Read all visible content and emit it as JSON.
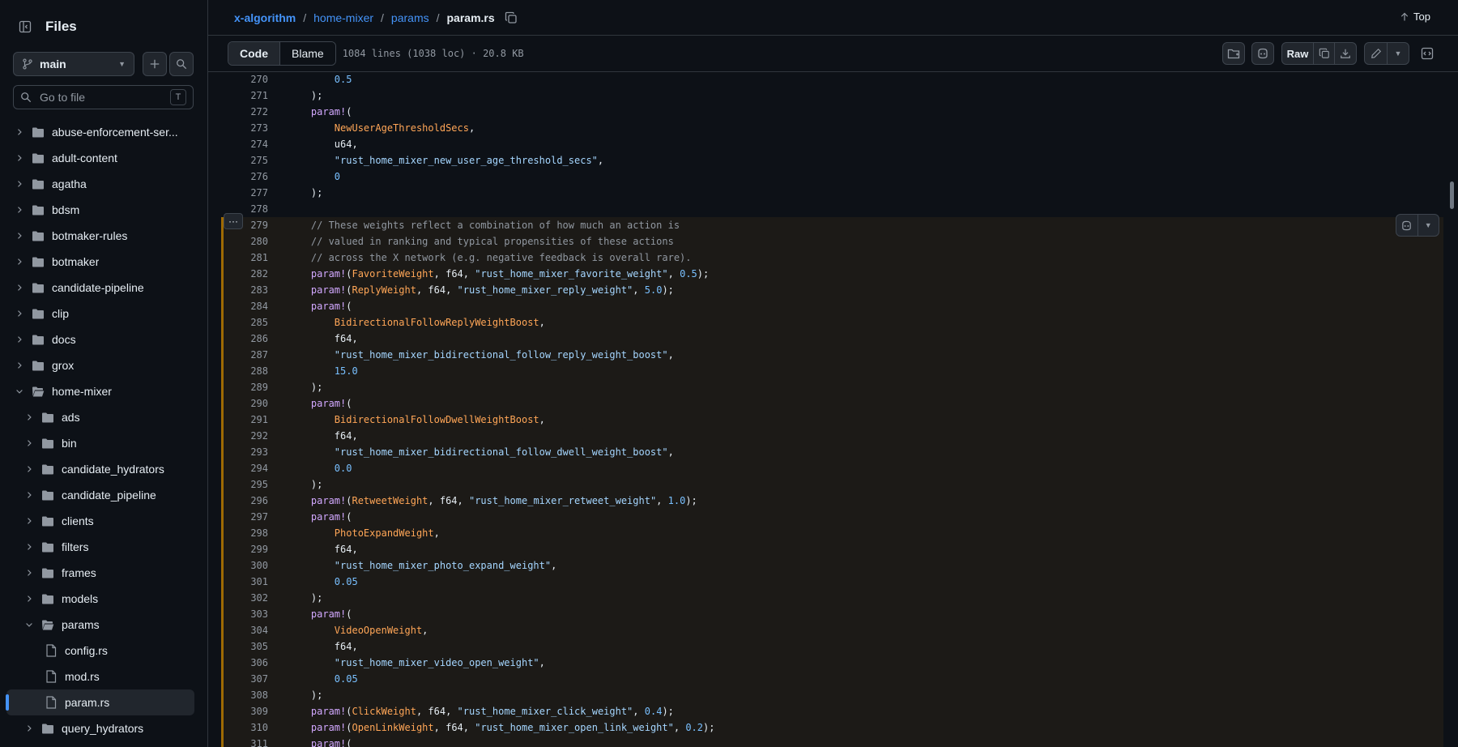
{
  "sidebar": {
    "title": "Files",
    "branch": "main",
    "goto_placeholder": "Go to file",
    "goto_shortcut": "T",
    "items": [
      {
        "label": "abuse-enforcement-ser...",
        "type": "folder",
        "depth": 0,
        "expanded": false
      },
      {
        "label": "adult-content",
        "type": "folder",
        "depth": 0,
        "expanded": false
      },
      {
        "label": "agatha",
        "type": "folder",
        "depth": 0,
        "expanded": false
      },
      {
        "label": "bdsm",
        "type": "folder",
        "depth": 0,
        "expanded": false
      },
      {
        "label": "botmaker-rules",
        "type": "folder",
        "depth": 0,
        "expanded": false
      },
      {
        "label": "botmaker",
        "type": "folder",
        "depth": 0,
        "expanded": false
      },
      {
        "label": "candidate-pipeline",
        "type": "folder",
        "depth": 0,
        "expanded": false
      },
      {
        "label": "clip",
        "type": "folder",
        "depth": 0,
        "expanded": false
      },
      {
        "label": "docs",
        "type": "folder",
        "depth": 0,
        "expanded": false
      },
      {
        "label": "grox",
        "type": "folder",
        "depth": 0,
        "expanded": false
      },
      {
        "label": "home-mixer",
        "type": "folder",
        "depth": 0,
        "expanded": true
      },
      {
        "label": "ads",
        "type": "folder",
        "depth": 1,
        "expanded": false
      },
      {
        "label": "bin",
        "type": "folder",
        "depth": 1,
        "expanded": false
      },
      {
        "label": "candidate_hydrators",
        "type": "folder",
        "depth": 1,
        "expanded": false
      },
      {
        "label": "candidate_pipeline",
        "type": "folder",
        "depth": 1,
        "expanded": false
      },
      {
        "label": "clients",
        "type": "folder",
        "depth": 1,
        "expanded": false
      },
      {
        "label": "filters",
        "type": "folder",
        "depth": 1,
        "expanded": false
      },
      {
        "label": "frames",
        "type": "folder",
        "depth": 1,
        "expanded": false
      },
      {
        "label": "models",
        "type": "folder",
        "depth": 1,
        "expanded": false
      },
      {
        "label": "params",
        "type": "folder",
        "depth": 1,
        "expanded": true
      },
      {
        "label": "config.rs",
        "type": "file",
        "depth": 2
      },
      {
        "label": "mod.rs",
        "type": "file",
        "depth": 2
      },
      {
        "label": "param.rs",
        "type": "file",
        "depth": 2,
        "selected": true
      },
      {
        "label": "query_hydrators",
        "type": "folder",
        "depth": 1,
        "expanded": false
      }
    ]
  },
  "breadcrumb": {
    "root": "x-algorithm",
    "parts": [
      "home-mixer",
      "params"
    ],
    "current": "param.rs",
    "sep": "/"
  },
  "top_link": "Top",
  "toolbar": {
    "code_tab": "Code",
    "blame_tab": "Blame",
    "file_info": "1084 lines (1038 loc) · 20.8 KB",
    "raw_label": "Raw"
  },
  "code_lines": [
    {
      "n": "270",
      "hl": false,
      "tokens": [
        [
          "num",
          "        0.5"
        ]
      ]
    },
    {
      "n": "271",
      "hl": false,
      "tokens": [
        [
          "pl",
          "    );"
        ]
      ]
    },
    {
      "n": "272",
      "hl": false,
      "tokens": [
        [
          "mac",
          "    param!"
        ],
        [
          "pl",
          "("
        ]
      ]
    },
    {
      "n": "273",
      "hl": false,
      "tokens": [
        [
          "id",
          "        NewUserAgeThresholdSecs"
        ],
        [
          "pl",
          ","
        ]
      ]
    },
    {
      "n": "274",
      "hl": false,
      "tokens": [
        [
          "pl",
          "        u64,"
        ]
      ]
    },
    {
      "n": "275",
      "hl": false,
      "tokens": [
        [
          "str",
          "        \"rust_home_mixer_new_user_age_threshold_secs\""
        ],
        [
          "pl",
          ","
        ]
      ]
    },
    {
      "n": "276",
      "hl": false,
      "tokens": [
        [
          "num",
          "        0"
        ]
      ]
    },
    {
      "n": "277",
      "hl": false,
      "tokens": [
        [
          "pl",
          "    );"
        ]
      ]
    },
    {
      "n": "278",
      "hl": false,
      "tokens": [
        [
          "pl",
          ""
        ]
      ]
    },
    {
      "n": "279",
      "hl": true,
      "tokens": [
        [
          "com",
          "    // These weights reflect a combination of how much an action is"
        ]
      ]
    },
    {
      "n": "280",
      "hl": true,
      "tokens": [
        [
          "com",
          "    // valued in ranking and typical propensities of these actions"
        ]
      ]
    },
    {
      "n": "281",
      "hl": true,
      "tokens": [
        [
          "com",
          "    // across the X network (e.g. negative feedback is overall rare)."
        ]
      ]
    },
    {
      "n": "282",
      "hl": true,
      "tokens": [
        [
          "mac",
          "    param!"
        ],
        [
          "pl",
          "("
        ],
        [
          "id",
          "FavoriteWeight"
        ],
        [
          "pl",
          ", f64, "
        ],
        [
          "str",
          "\"rust_home_mixer_favorite_weight\""
        ],
        [
          "pl",
          ", "
        ],
        [
          "num",
          "0.5"
        ],
        [
          "pl",
          ");"
        ]
      ]
    },
    {
      "n": "283",
      "hl": true,
      "tokens": [
        [
          "mac",
          "    param!"
        ],
        [
          "pl",
          "("
        ],
        [
          "id",
          "ReplyWeight"
        ],
        [
          "pl",
          ", f64, "
        ],
        [
          "str",
          "\"rust_home_mixer_reply_weight\""
        ],
        [
          "pl",
          ", "
        ],
        [
          "num",
          "5.0"
        ],
        [
          "pl",
          ");"
        ]
      ]
    },
    {
      "n": "284",
      "hl": true,
      "tokens": [
        [
          "mac",
          "    param!"
        ],
        [
          "pl",
          "("
        ]
      ]
    },
    {
      "n": "285",
      "hl": true,
      "tokens": [
        [
          "id",
          "        BidirectionalFollowReplyWeightBoost"
        ],
        [
          "pl",
          ","
        ]
      ]
    },
    {
      "n": "286",
      "hl": true,
      "tokens": [
        [
          "pl",
          "        f64,"
        ]
      ]
    },
    {
      "n": "287",
      "hl": true,
      "tokens": [
        [
          "str",
          "        \"rust_home_mixer_bidirectional_follow_reply_weight_boost\""
        ],
        [
          "pl",
          ","
        ]
      ]
    },
    {
      "n": "288",
      "hl": true,
      "tokens": [
        [
          "num",
          "        15.0"
        ]
      ]
    },
    {
      "n": "289",
      "hl": true,
      "tokens": [
        [
          "pl",
          "    );"
        ]
      ]
    },
    {
      "n": "290",
      "hl": true,
      "tokens": [
        [
          "mac",
          "    param!"
        ],
        [
          "pl",
          "("
        ]
      ]
    },
    {
      "n": "291",
      "hl": true,
      "tokens": [
        [
          "id",
          "        BidirectionalFollowDwellWeightBoost"
        ],
        [
          "pl",
          ","
        ]
      ]
    },
    {
      "n": "292",
      "hl": true,
      "tokens": [
        [
          "pl",
          "        f64,"
        ]
      ]
    },
    {
      "n": "293",
      "hl": true,
      "tokens": [
        [
          "str",
          "        \"rust_home_mixer_bidirectional_follow_dwell_weight_boost\""
        ],
        [
          "pl",
          ","
        ]
      ]
    },
    {
      "n": "294",
      "hl": true,
      "tokens": [
        [
          "num",
          "        0.0"
        ]
      ]
    },
    {
      "n": "295",
      "hl": true,
      "tokens": [
        [
          "pl",
          "    );"
        ]
      ]
    },
    {
      "n": "296",
      "hl": true,
      "tokens": [
        [
          "mac",
          "    param!"
        ],
        [
          "pl",
          "("
        ],
        [
          "id",
          "RetweetWeight"
        ],
        [
          "pl",
          ", f64, "
        ],
        [
          "str",
          "\"rust_home_mixer_retweet_weight\""
        ],
        [
          "pl",
          ", "
        ],
        [
          "num",
          "1.0"
        ],
        [
          "pl",
          ");"
        ]
      ]
    },
    {
      "n": "297",
      "hl": true,
      "tokens": [
        [
          "mac",
          "    param!"
        ],
        [
          "pl",
          "("
        ]
      ]
    },
    {
      "n": "298",
      "hl": true,
      "tokens": [
        [
          "id",
          "        PhotoExpandWeight"
        ],
        [
          "pl",
          ","
        ]
      ]
    },
    {
      "n": "299",
      "hl": true,
      "tokens": [
        [
          "pl",
          "        f64,"
        ]
      ]
    },
    {
      "n": "300",
      "hl": true,
      "tokens": [
        [
          "str",
          "        \"rust_home_mixer_photo_expand_weight\""
        ],
        [
          "pl",
          ","
        ]
      ]
    },
    {
      "n": "301",
      "hl": true,
      "tokens": [
        [
          "num",
          "        0.05"
        ]
      ]
    },
    {
      "n": "302",
      "hl": true,
      "tokens": [
        [
          "pl",
          "    );"
        ]
      ]
    },
    {
      "n": "303",
      "hl": true,
      "tokens": [
        [
          "mac",
          "    param!"
        ],
        [
          "pl",
          "("
        ]
      ]
    },
    {
      "n": "304",
      "hl": true,
      "tokens": [
        [
          "id",
          "        VideoOpenWeight"
        ],
        [
          "pl",
          ","
        ]
      ]
    },
    {
      "n": "305",
      "hl": true,
      "tokens": [
        [
          "pl",
          "        f64,"
        ]
      ]
    },
    {
      "n": "306",
      "hl": true,
      "tokens": [
        [
          "str",
          "        \"rust_home_mixer_video_open_weight\""
        ],
        [
          "pl",
          ","
        ]
      ]
    },
    {
      "n": "307",
      "hl": true,
      "tokens": [
        [
          "num",
          "        0.05"
        ]
      ]
    },
    {
      "n": "308",
      "hl": true,
      "tokens": [
        [
          "pl",
          "    );"
        ]
      ]
    },
    {
      "n": "309",
      "hl": true,
      "tokens": [
        [
          "mac",
          "    param!"
        ],
        [
          "pl",
          "("
        ],
        [
          "id",
          "ClickWeight"
        ],
        [
          "pl",
          ", f64, "
        ],
        [
          "str",
          "\"rust_home_mixer_click_weight\""
        ],
        [
          "pl",
          ", "
        ],
        [
          "num",
          "0.4"
        ],
        [
          "pl",
          ");"
        ]
      ]
    },
    {
      "n": "310",
      "hl": true,
      "tokens": [
        [
          "mac",
          "    param!"
        ],
        [
          "pl",
          "("
        ],
        [
          "id",
          "OpenLinkWeight"
        ],
        [
          "pl",
          ", f64, "
        ],
        [
          "str",
          "\"rust_home_mixer_open_link_weight\""
        ],
        [
          "pl",
          ", "
        ],
        [
          "num",
          "0.2"
        ],
        [
          "pl",
          ");"
        ]
      ]
    },
    {
      "n": "311",
      "hl": true,
      "tokens": [
        [
          "mac",
          "    param!"
        ],
        [
          "pl",
          "("
        ]
      ]
    }
  ],
  "colors": {
    "accent": "#4493f8",
    "highlight_bar": "#9e6a03"
  }
}
